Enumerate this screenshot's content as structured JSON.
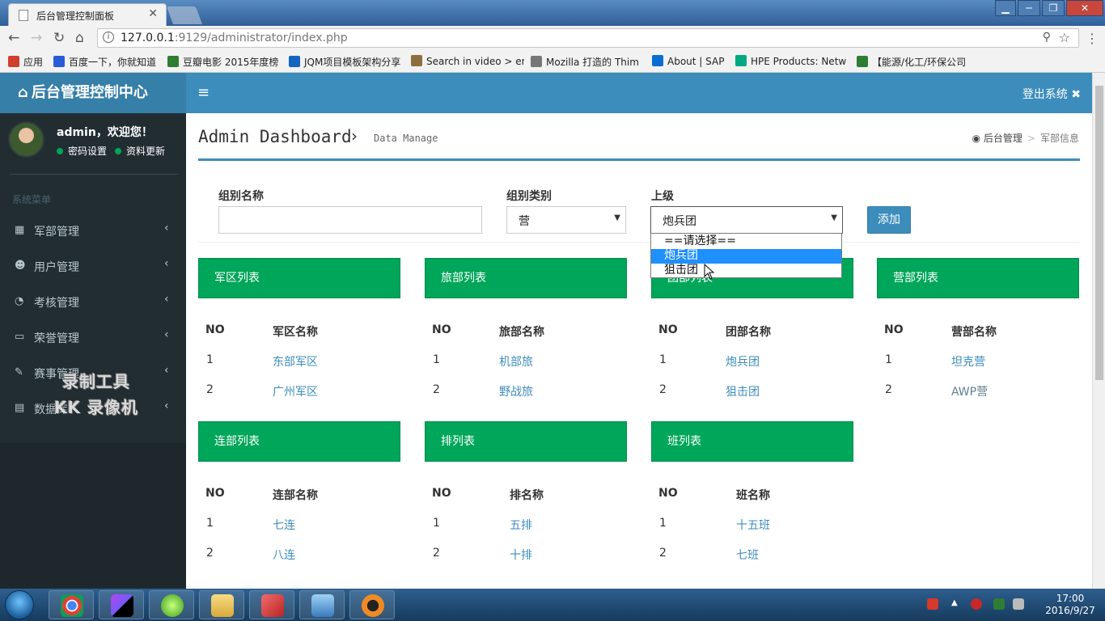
{
  "browser": {
    "tab_title": "后台管理控制面板",
    "url_host": "127.0.0.1",
    "url_path": ":9129/administrator/index.php",
    "bookmarks": [
      {
        "label": "应用",
        "color": "#cf3f2f"
      },
      {
        "label": "百度一下，你就知道",
        "color": "#2a5bd7"
      },
      {
        "label": "豆瓣电影 2015年度榜",
        "color": "#2e7d32"
      },
      {
        "label": "JQM项目模板架构分享",
        "color": "#1565c0"
      },
      {
        "label": "Search in video > er",
        "color": "#8d6e3f"
      },
      {
        "label": "Mozilla 打造的 Thim",
        "color": "#777777"
      },
      {
        "label": "About | SAP",
        "color": "#0a6ed1"
      },
      {
        "label": "HPE Products: Netw",
        "color": "#01a982"
      },
      {
        "label": "【能源/化工/环保公司",
        "color": "#2e7d32"
      }
    ]
  },
  "header": {
    "brand": "后台管理控制中心",
    "logout": "登出系统"
  },
  "user": {
    "greeting": "admin，欢迎您！",
    "links": [
      "密码设置",
      "资料更新"
    ]
  },
  "sidebar": {
    "header": "系统菜单",
    "items": [
      {
        "label": "军部管理",
        "icon": "grid-icon"
      },
      {
        "label": "用户管理",
        "icon": "users-icon"
      },
      {
        "label": "考核管理",
        "icon": "pie-chart-icon"
      },
      {
        "label": "荣誉管理",
        "icon": "laptop-icon"
      },
      {
        "label": "赛事管理",
        "icon": "edit-icon"
      },
      {
        "label": "数据库",
        "icon": "table-icon"
      }
    ],
    "watermark": [
      "录制工具",
      "KK 录像机"
    ]
  },
  "page": {
    "title": "Admin Dashboard",
    "subtitle": "Data Manage",
    "breadcrumb": [
      "后台管理",
      "军部信息"
    ]
  },
  "form": {
    "group_name_label": "组别名称",
    "group_name_value": "",
    "group_type_label": "组别类别",
    "group_type_value": "营",
    "parent_label": "上级",
    "parent_value": "炮兵团",
    "parent_options": [
      "==请选择==",
      "炮兵团",
      "狙击团"
    ],
    "parent_selected_index": 1,
    "add_button": "添加"
  },
  "cards": [
    {
      "title": "军区列表",
      "col_no": "NO",
      "col_name": "军区名称",
      "rows": [
        {
          "no": "1",
          "name": "东部军区"
        },
        {
          "no": "2",
          "name": "广州军区"
        }
      ]
    },
    {
      "title": "旅部列表",
      "col_no": "NO",
      "col_name": "旅部名称",
      "rows": [
        {
          "no": "1",
          "name": "机部旅"
        },
        {
          "no": "2",
          "name": "野战旅"
        }
      ]
    },
    {
      "title": "团部列表",
      "col_no": "NO",
      "col_name": "团部名称",
      "rows": [
        {
          "no": "1",
          "name": "炮兵团"
        },
        {
          "no": "2",
          "name": "狙击团"
        }
      ]
    },
    {
      "title": "营部列表",
      "col_no": "NO",
      "col_name": "营部名称",
      "rows": [
        {
          "no": "1",
          "name": "坦克营"
        },
        {
          "no": "2",
          "name": "AWP营"
        }
      ]
    },
    {
      "title": "连部列表",
      "col_no": "NO",
      "col_name": "连部名称",
      "rows": [
        {
          "no": "1",
          "name": "七连"
        },
        {
          "no": "2",
          "name": "八连"
        }
      ]
    },
    {
      "title": "排列表",
      "col_no": "NO",
      "col_name": "排名称",
      "rows": [
        {
          "no": "1",
          "name": "五排"
        },
        {
          "no": "2",
          "name": "十排"
        }
      ]
    },
    {
      "title": "班列表",
      "col_no": "NO",
      "col_name": "班名称",
      "rows": [
        {
          "no": "1",
          "name": "十五班"
        },
        {
          "no": "2",
          "name": "七班"
        }
      ]
    }
  ],
  "taskbar": {
    "time": "17:00",
    "date": "2016/9/27"
  },
  "colors": {
    "primary": "#3c8dbc",
    "success": "#00a65a",
    "sidebar": "#222d32"
  }
}
